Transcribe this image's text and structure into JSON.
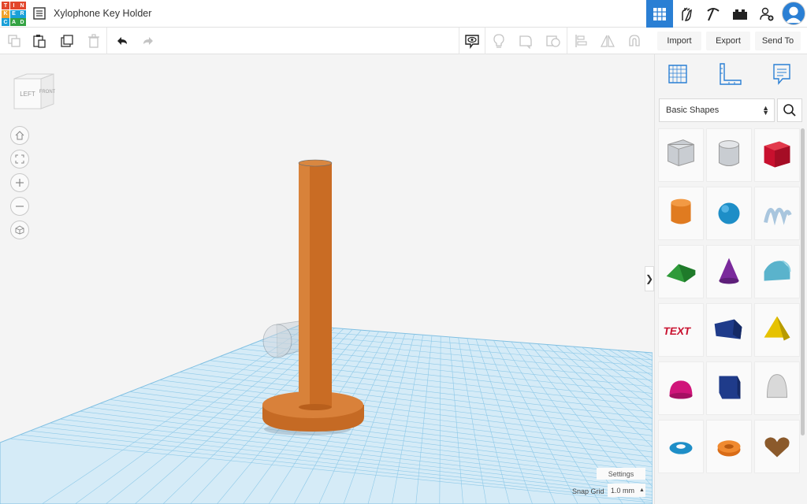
{
  "app": {
    "logo_letters": [
      "T",
      "I",
      "N",
      "K",
      "E",
      "R",
      "C",
      "A",
      "D"
    ],
    "logo_colors": [
      "#e2462c",
      "#e2462c",
      "#e2462c",
      "#f1a22b",
      "#1aa0d8",
      "#1aa0d8",
      "#1aa0d8",
      "#33a343",
      "#33a343"
    ],
    "document_title": "Xylophone Key Holder"
  },
  "header": {
    "right_icons": [
      "3d-design-grid-icon",
      "gallery-icon",
      "pickaxe-icon",
      "bricks-icon",
      "add-user-icon",
      "avatar-icon"
    ]
  },
  "toolbar": {
    "left_tools": [
      "copy-icon",
      "paste-icon",
      "duplicate-icon",
      "delete-icon",
      "undo-icon",
      "redo-icon"
    ],
    "right_tools": [
      "view-icon",
      "light-icon",
      "shape-notes-icon",
      "group-icon",
      "align-icon",
      "mirror-icon",
      "ruler-magnet-icon"
    ],
    "import_label": "Import",
    "export_label": "Export",
    "send_to_label": "Send To"
  },
  "panel": {
    "tabs": [
      "workplane-tab",
      "ruler-tab",
      "notes-tab"
    ],
    "library_selected": "Basic Shapes",
    "shapes": [
      "box-hole",
      "cylinder-hole",
      "box",
      "cylinder",
      "sphere",
      "scribble",
      "roof",
      "cone",
      "round-roof",
      "text",
      "wedge",
      "pyramid",
      "half-sphere",
      "polygon",
      "paraboloid",
      "torus",
      "tube",
      "heart"
    ]
  },
  "workplane": {
    "viewcube_left": "LEFT",
    "viewcube_front": "FRONT",
    "settings_label": "Settings",
    "snap_grid_label": "Snap Grid",
    "snap_grid_value": "1.0 mm",
    "colors": {
      "grid": "#8ec9e8",
      "plane": "#cfe8f6",
      "object": "#d4772a",
      "accent": "#2a7fd4"
    }
  }
}
